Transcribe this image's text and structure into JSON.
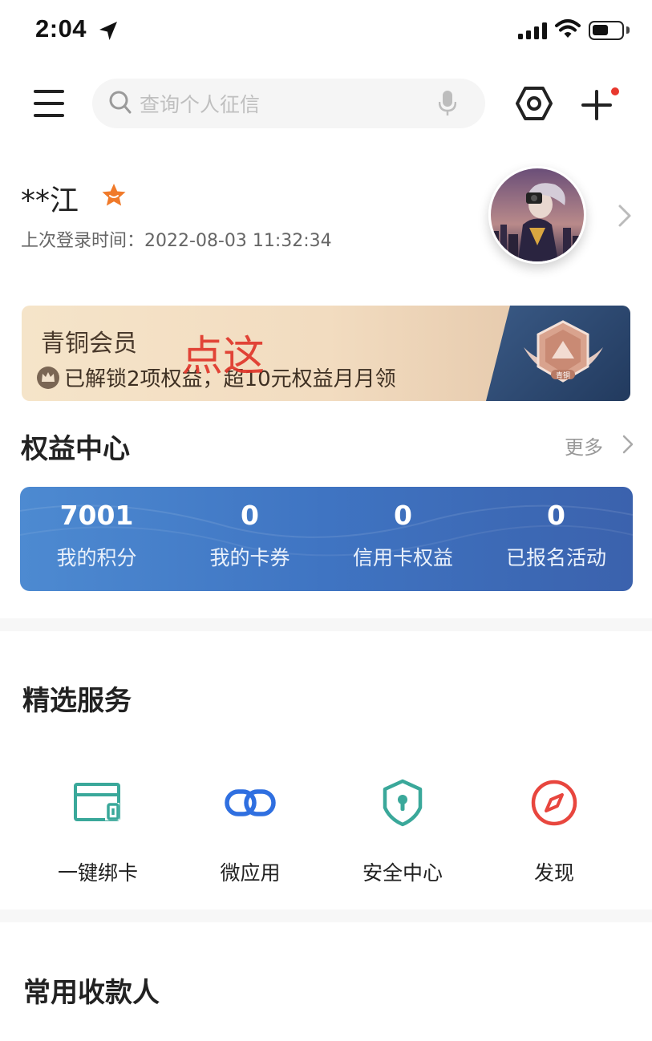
{
  "status_bar": {
    "time": "2:04"
  },
  "search": {
    "placeholder": "查询个人征信"
  },
  "profile": {
    "name": "**江",
    "last_login_label": "上次登录时间：",
    "last_login_time": "2022-08-03 11:32:34"
  },
  "member": {
    "title": "青铜会员",
    "description": "已解锁2项权益，超10元权益月月领",
    "overlay_text": "点这",
    "badge_text": "青铜"
  },
  "rights_center": {
    "title": "权益中心",
    "more_label": "更多",
    "stats": [
      {
        "value": "7001",
        "label": "我的积分"
      },
      {
        "value": "0",
        "label": "我的卡券"
      },
      {
        "value": "0",
        "label": "信用卡权益"
      },
      {
        "value": "0",
        "label": "已报名活动"
      }
    ]
  },
  "services": {
    "title": "精选服务",
    "items": [
      {
        "label": "一键绑卡",
        "icon": "bind-card-icon",
        "color": "#3aa89a"
      },
      {
        "label": "微应用",
        "icon": "link-icon",
        "color": "#2f6fe0"
      },
      {
        "label": "安全中心",
        "icon": "shield-icon",
        "color": "#3aa89a"
      },
      {
        "label": "发现",
        "icon": "compass-icon",
        "color": "#e8463e"
      }
    ]
  },
  "payees": {
    "title": "常用收款人"
  },
  "colors": {
    "accent_red": "#e0362b",
    "rights_blue": "#3f74c2",
    "star_orange": "#f07a2a"
  }
}
